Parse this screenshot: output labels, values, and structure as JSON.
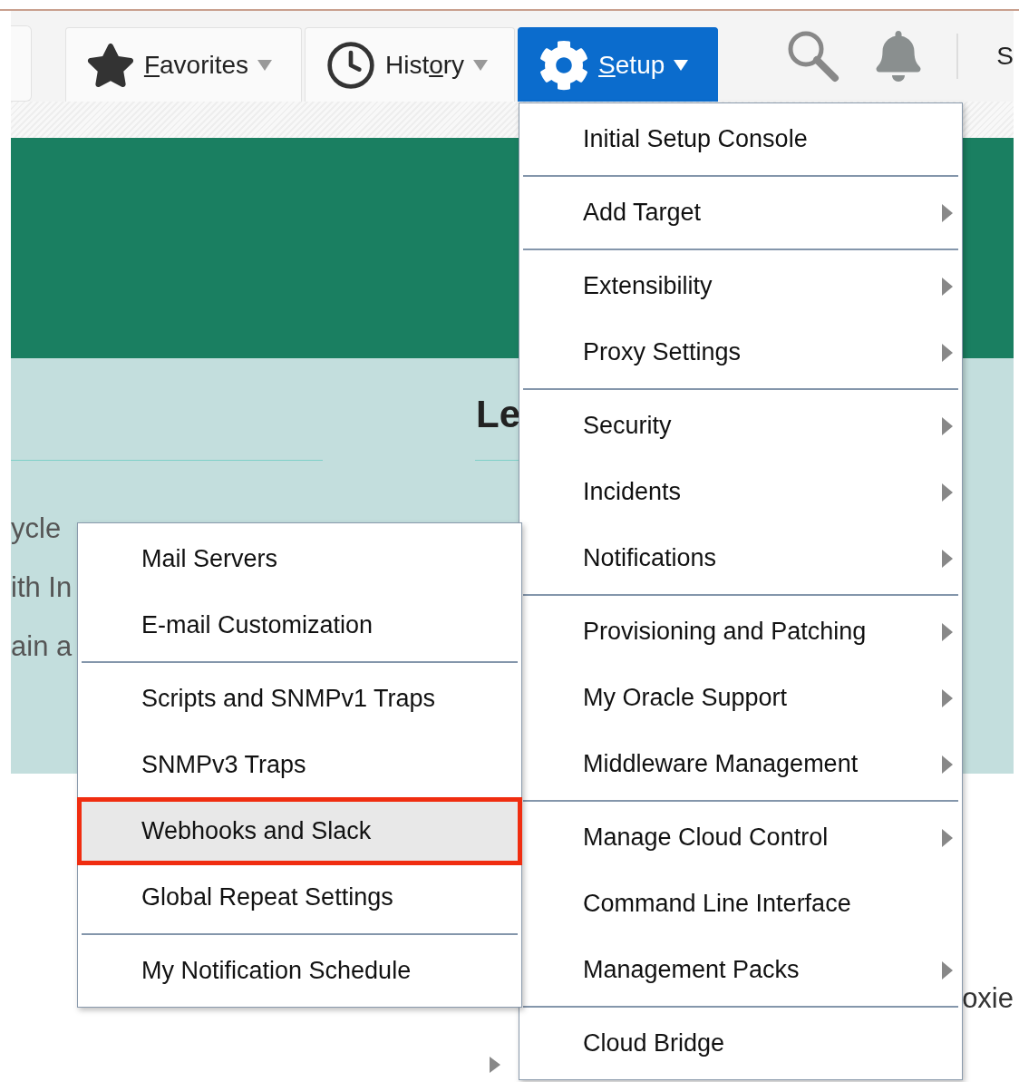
{
  "toolbar": {
    "edge_label": "S",
    "buttons": [
      {
        "kind": "favorites",
        "mnemonic": "F",
        "after": "avorites",
        "selected": false
      },
      {
        "kind": "history",
        "before": "Hist",
        "mnemonic": "o",
        "after": "ry",
        "selected": false
      },
      {
        "kind": "setup",
        "mnemonic": "S",
        "after": "etup",
        "selected": true
      }
    ]
  },
  "page": {
    "heading": "Le",
    "lines": [
      "ycle",
      "ith In",
      "ain a"
    ],
    "right_text": "oxie"
  },
  "setup_menu": {
    "groups": [
      [
        {
          "label": "Initial Setup Console",
          "submenu": false
        }
      ],
      [
        {
          "label": "Add Target",
          "submenu": true
        }
      ],
      [
        {
          "label": "Extensibility",
          "submenu": true
        },
        {
          "label": "Proxy Settings",
          "submenu": true
        }
      ],
      [
        {
          "label": "Security",
          "submenu": true
        },
        {
          "label": "Incidents",
          "submenu": true
        },
        {
          "label": "Notifications",
          "submenu": true
        }
      ],
      [
        {
          "label": "Provisioning and Patching",
          "submenu": true
        },
        {
          "label": "My Oracle Support",
          "submenu": true
        },
        {
          "label": "Middleware Management",
          "submenu": true
        }
      ],
      [
        {
          "label": "Manage Cloud Control",
          "submenu": true
        },
        {
          "label": "Command Line Interface",
          "submenu": false
        },
        {
          "label": "Management Packs",
          "submenu": true
        }
      ],
      [
        {
          "label": "Cloud Bridge",
          "submenu": false
        }
      ]
    ]
  },
  "notifications_submenu": {
    "groups": [
      [
        {
          "label": "Mail Servers",
          "selected": false
        },
        {
          "label": "E-mail Customization",
          "selected": false
        }
      ],
      [
        {
          "label": "Scripts and SNMPv1 Traps",
          "selected": false
        },
        {
          "label": "SNMPv3 Traps",
          "selected": false
        },
        {
          "label": "Webhooks and Slack",
          "selected": true
        },
        {
          "label": "Global Repeat Settings",
          "selected": false
        }
      ],
      [
        {
          "label": "My Notification Schedule",
          "selected": false
        }
      ]
    ]
  }
}
